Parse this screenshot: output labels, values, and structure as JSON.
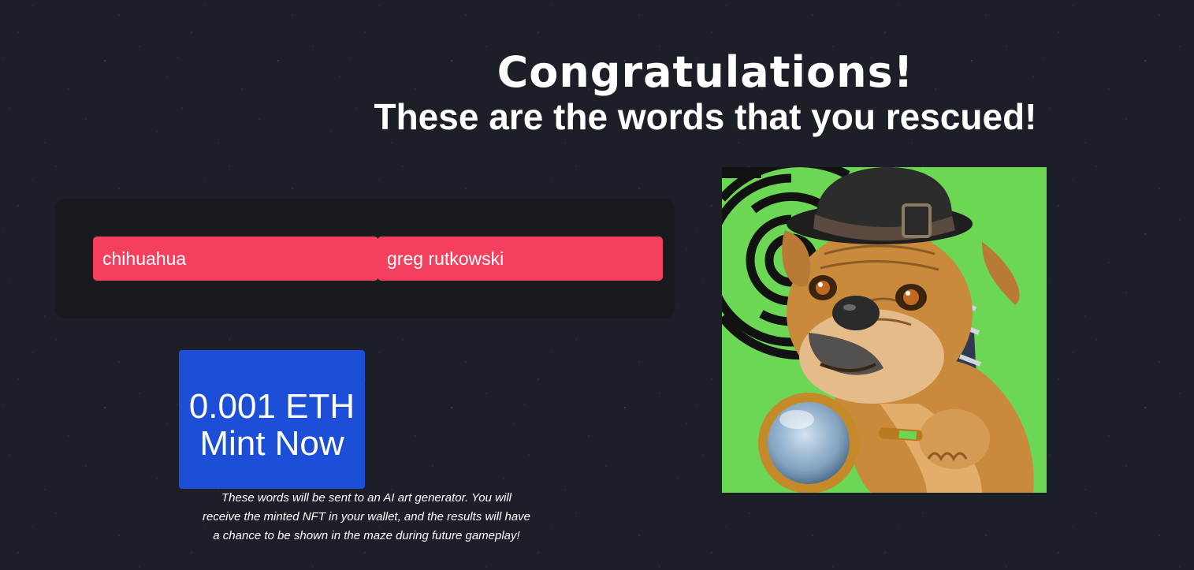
{
  "header": {
    "title": "Congratulations!",
    "subtitle": "These are the words that you rescued!"
  },
  "words": [
    "chihuahua",
    "greg rutkowski"
  ],
  "mint": {
    "label": "0.001 ETH Mint Now"
  },
  "disclaimer": "These words will be sent to an AI art generator. You will receive the minted NFT in your wallet, and the results will have a chance to be shown in the maze during future gameplay!",
  "image": {
    "subject": "bulldog detective with bowler hat and magnifying glass on green maze background"
  },
  "colors": {
    "background": "#1c1f27",
    "panel": "#191a20",
    "word_chip": "#f43f5e",
    "mint_button": "#1d4ed8",
    "image_background": "#6cd655"
  }
}
